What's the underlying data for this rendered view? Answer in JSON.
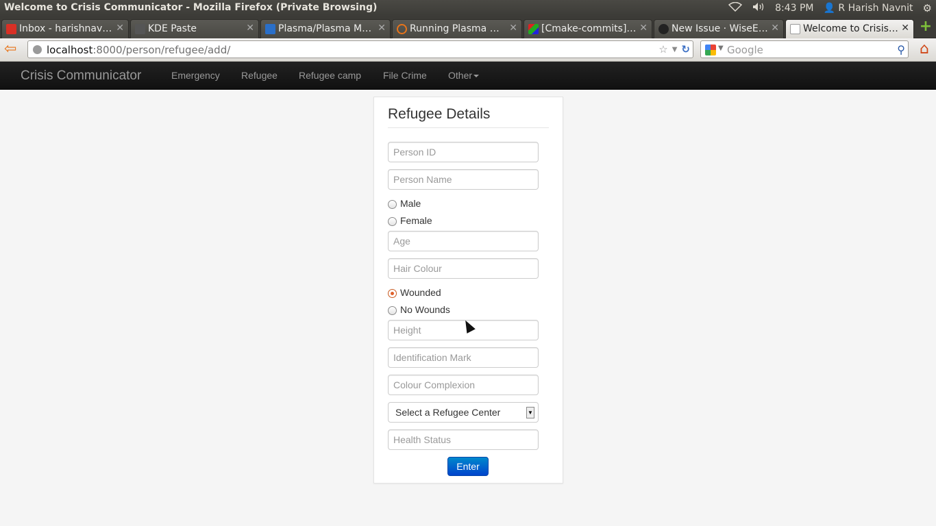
{
  "os": {
    "window_title": "Welcome to Crisis Communicator - Mozilla Firefox (Private Browsing)",
    "clock": "8:43 PM",
    "user": "R Harish Navnit"
  },
  "tabs": [
    {
      "label": "Inbox - harishnavni…",
      "icon": "gmail-icon",
      "active": false
    },
    {
      "label": "KDE Paste",
      "icon": "page-icon",
      "active": false
    },
    {
      "label": "Plasma/Plasma M…",
      "icon": "kde-icon",
      "active": false
    },
    {
      "label": "Running Plasma M…",
      "icon": "loading-icon",
      "active": false
    },
    {
      "label": "[Cmake-commits] …",
      "icon": "cmake-icon",
      "active": false
    },
    {
      "label": "New Issue · WiseEa…",
      "icon": "github-icon",
      "active": false
    },
    {
      "label": "Welcome to Crisis …",
      "icon": "blank-page-icon",
      "active": true
    }
  ],
  "urlbar": {
    "host": "localhost",
    "rest": ":8000/person/refugee/add/"
  },
  "search": {
    "placeholder": "Google"
  },
  "app_nav": {
    "brand": "Crisis Communicator",
    "items": [
      "Emergency",
      "Refugee",
      "Refugee camp",
      "File Crime",
      "Other"
    ]
  },
  "form": {
    "title": "Refugee Details",
    "person_id_placeholder": "Person ID",
    "person_name_placeholder": "Person Name",
    "gender_options": [
      "Male",
      "Female"
    ],
    "age_placeholder": "Age",
    "hair_placeholder": "Hair Colour",
    "wound_options": [
      "Wounded",
      "No Wounds"
    ],
    "wound_selected": "Wounded",
    "height_placeholder": "Height",
    "id_mark_placeholder": "Identification Mark",
    "complexion_placeholder": "Colour Complexion",
    "center_select": "Select a Refugee Center",
    "health_placeholder": "Health Status",
    "submit_label": "Enter"
  },
  "colors": {
    "navbar_bg": "#1b1b1b",
    "button_primary": "#0066cc",
    "radio_checked": "#e0602a"
  }
}
